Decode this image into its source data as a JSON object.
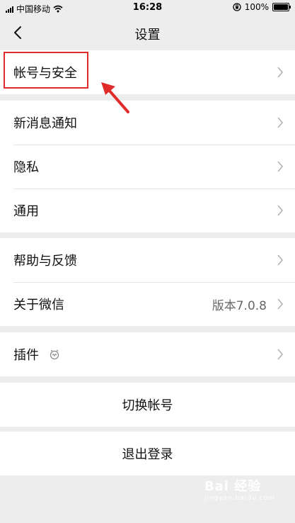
{
  "status_bar": {
    "carrier": "中国移动",
    "time": "16:28",
    "battery": "100%",
    "battery_level": 1.0
  },
  "nav": {
    "title": "设置"
  },
  "groups": {
    "account": {
      "label": "帐号与安全"
    },
    "messages": {
      "label": "新消息通知"
    },
    "privacy": {
      "label": "隐私"
    },
    "general": {
      "label": "通用"
    },
    "help": {
      "label": "帮助与反馈"
    },
    "about": {
      "label": "关于微信",
      "value": "版本7.0.8"
    },
    "plugins": {
      "label": "插件"
    }
  },
  "actions": {
    "switch_account": "切换帐号",
    "logout": "退出登录"
  },
  "watermark": {
    "text": "Bai 经验",
    "sub": "jingyan.baidu.com"
  },
  "colors": {
    "background": "#ededed",
    "highlight": "#e12b2b",
    "chevron": "#b2b2b2"
  }
}
